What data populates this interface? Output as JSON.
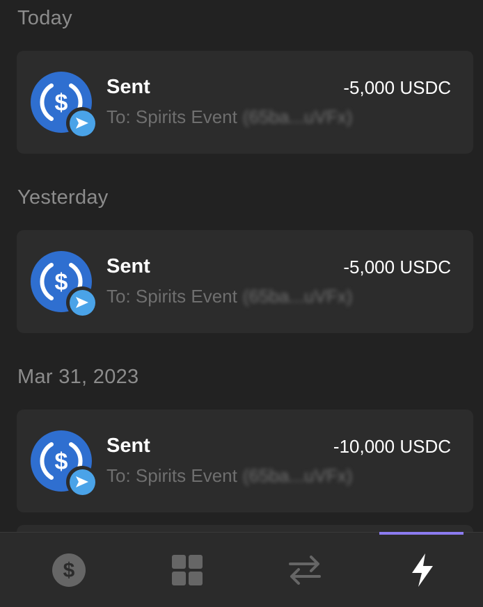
{
  "groups": [
    {
      "header": "Today",
      "tx": {
        "title": "Sent",
        "amount": "-5,000 USDC",
        "to_label": "To: Spirits Event",
        "address": "(65ba...uVFx)",
        "coin_icon": "usdc-coin-icon",
        "badge_icon": "send-arrow-icon"
      }
    },
    {
      "header": "Yesterday",
      "tx": {
        "title": "Sent",
        "amount": "-5,000 USDC",
        "to_label": "To: Spirits Event",
        "address": "(65ba...uVFx)",
        "coin_icon": "usdc-coin-icon",
        "badge_icon": "send-arrow-icon"
      }
    },
    {
      "header": "Mar 31, 2023",
      "tx": {
        "title": "Sent",
        "amount": "-10,000 USDC",
        "to_label": "To: Spirits Event",
        "address": "(65ba...uVFx)",
        "coin_icon": "usdc-coin-icon",
        "badge_icon": "send-arrow-icon"
      }
    }
  ],
  "tabbar": {
    "tabs": [
      {
        "icon": "dollar-coin-icon",
        "active": false
      },
      {
        "icon": "grid-apps-icon",
        "active": false
      },
      {
        "icon": "swap-arrows-icon",
        "active": false
      },
      {
        "icon": "lightning-bolt-icon",
        "active": true
      }
    ]
  },
  "colors": {
    "background": "#222222",
    "card": "#2c2c2c",
    "usdc_blue": "#2f6fd0",
    "send_badge": "#4aa3e8",
    "active_tab_indicator": "#8c7cf0",
    "muted_text": "#8c8c8c"
  }
}
